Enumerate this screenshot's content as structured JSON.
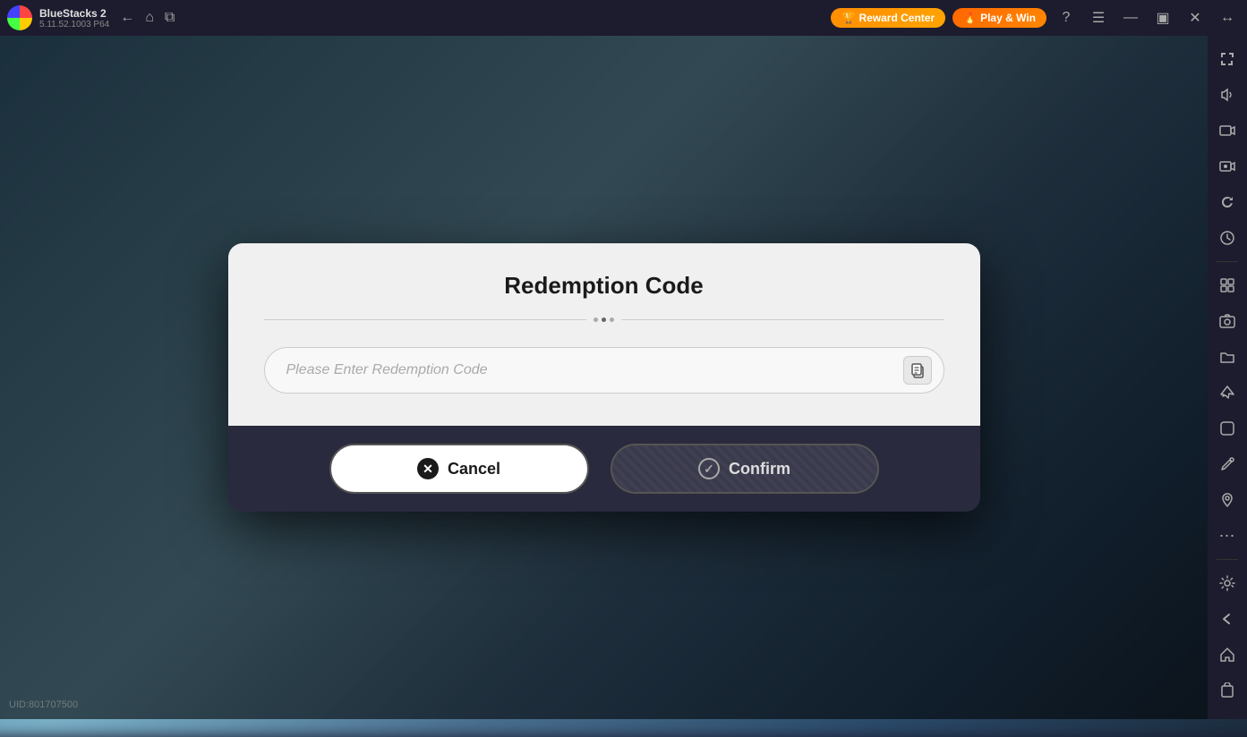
{
  "app": {
    "name": "BlueStacks 2",
    "version": "5.11.52.1003  P64"
  },
  "topbar": {
    "reward_label": "Reward Center",
    "play_win_label": "Play & Win",
    "reward_icon": "🏆",
    "play_icon": "🔥"
  },
  "nav_icons": [
    "←",
    "⌂",
    "⧉"
  ],
  "topbar_actions": [
    "?",
    "≡",
    "—",
    "⬜",
    "✕",
    "↔"
  ],
  "sidebar": {
    "icons": [
      "⛶",
      "🔊",
      "▶",
      "⬛",
      "↺",
      "⟳",
      "⚙",
      "📷",
      "📁",
      "✈",
      "◻",
      "✏",
      "📍",
      "⋯",
      "⚙",
      "←",
      "⌂",
      "📋"
    ]
  },
  "uid": {
    "label": "UID:801707500"
  },
  "modal": {
    "title": "Redemption Code",
    "input_placeholder": "Please Enter Redemption Code",
    "cancel_label": "Cancel",
    "confirm_label": "Confirm"
  }
}
